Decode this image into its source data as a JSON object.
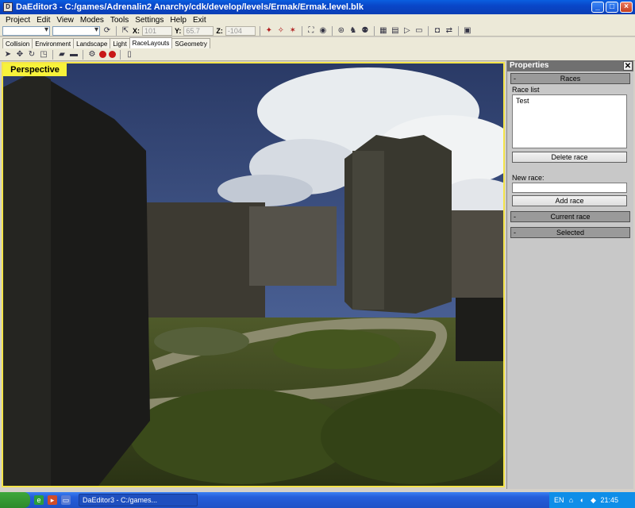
{
  "window": {
    "title": "DaEditor3 - C:/games/Adrenalin2 Anarchy/cdk/develop/levels/Ermak/Ermak.level.blk",
    "app_icon": "da-editor-icon"
  },
  "menu": [
    "Project",
    "Edit",
    "View",
    "Modes",
    "Tools",
    "Settings",
    "Help",
    "Exit"
  ],
  "coords": {
    "x_label": "X:",
    "x_value": "101",
    "y_label": "Y:",
    "y_value": "65.7",
    "z_label": "Z:",
    "z_value": "-104"
  },
  "tabs": [
    "Collision",
    "Environment",
    "Landscape",
    "Light",
    "RaceLayouts",
    "SGeometry"
  ],
  "active_tab": "RaceLayouts",
  "viewport": {
    "label": "Perspective"
  },
  "properties": {
    "title": "Properties",
    "close": "✕",
    "sections": {
      "races": "Races",
      "current_race": "Current race",
      "selected": "Selected"
    },
    "race_list_label": "Race list",
    "race_list": [
      "Test"
    ],
    "delete_race": "Delete race",
    "new_race_label": "New race:",
    "new_race_value": "",
    "add_race": "Add race",
    "collapse_marker": "-"
  },
  "taskbar": {
    "task_label": "DaEditor3 - C:/games...",
    "lang": "EN",
    "clock": "21:45"
  },
  "colors": {
    "viewport_border": "#f4e44a",
    "viewport_label_bg": "#f7f23a",
    "taskbar": "#245edb",
    "title_bar": "#0946c8"
  }
}
